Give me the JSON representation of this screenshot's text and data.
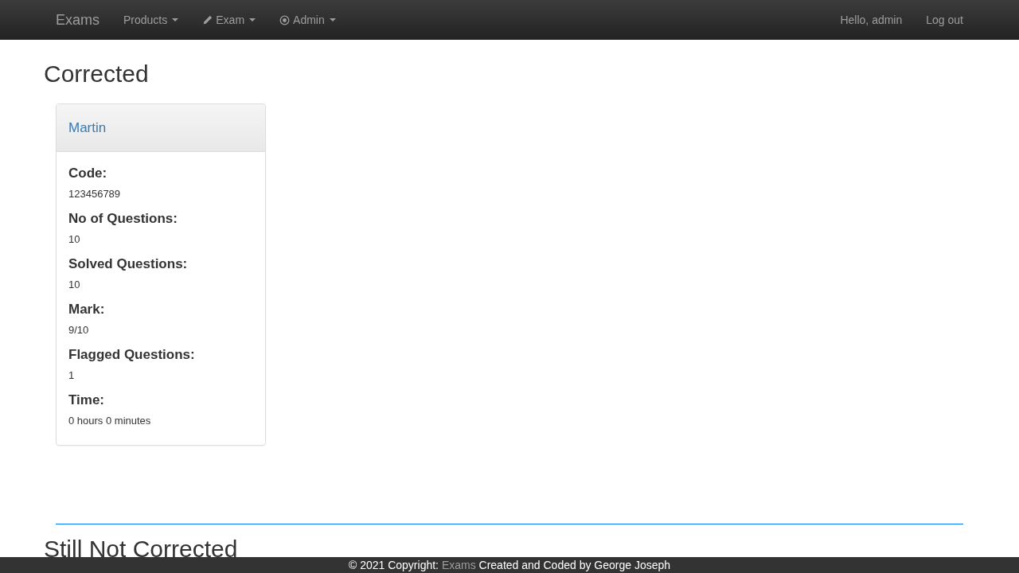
{
  "navbar": {
    "brand": "Exams",
    "menus": [
      {
        "label": "Products",
        "kind": "plain"
      },
      {
        "label": "Exam",
        "kind": "pencil"
      },
      {
        "label": "Admin",
        "kind": "record"
      }
    ],
    "greeting": "Hello, admin",
    "logout": "Log out"
  },
  "section_title": "Corrected",
  "cards": [
    {
      "name": "Martin",
      "fields": [
        {
          "label": "Code:",
          "value": "123456789"
        },
        {
          "label": "No of Questions:",
          "value": "10"
        },
        {
          "label": "Solved Questions:",
          "value": "10"
        },
        {
          "label": "Mark:",
          "value": "9/10"
        },
        {
          "label": "Flagged Questions:",
          "value": "1"
        },
        {
          "label": "Time:",
          "value": "0 hours 0 minutes"
        }
      ]
    }
  ],
  "next_section_title": "Still Not Corrected",
  "footer": {
    "prefix": "© 2021 Copyright:",
    "brand": "Exams",
    "suffix": "Created and Coded by George Joseph"
  }
}
